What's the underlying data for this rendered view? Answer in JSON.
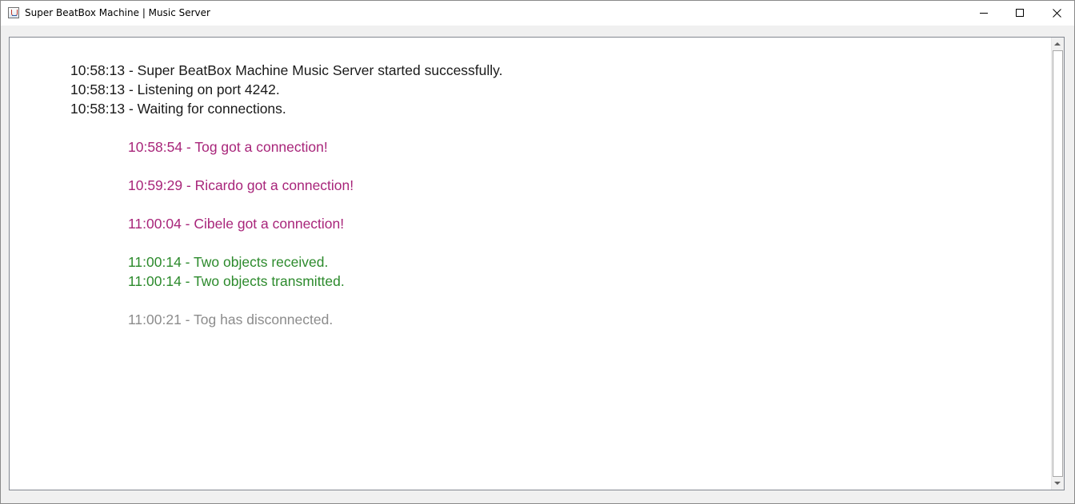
{
  "window": {
    "title": "Super BeatBox Machine | Music Server",
    "icon": "java-app-icon",
    "controls": {
      "minimize": "minimize-icon",
      "maximize": "maximize-icon",
      "close": "close-icon"
    }
  },
  "log": {
    "colors": {
      "system": "#1a1a1a",
      "connection": "#a8257a",
      "transfer": "#2c8a2c",
      "disconnect": "#8c8c8c"
    },
    "lines": [
      {
        "text": "10:58:13 - Super BeatBox Machine Music Server started successfully.",
        "kind": "system"
      },
      {
        "text": "10:58:13 - Listening on port 4242.",
        "kind": "system"
      },
      {
        "text": "10:58:13 - Waiting for connections.",
        "kind": "system"
      },
      {
        "text": "10:58:54 - Tog got a connection!",
        "kind": "connection"
      },
      {
        "text": "10:59:29 - Ricardo got a connection!",
        "kind": "connection"
      },
      {
        "text": "11:00:04 - Cibele got a connection!",
        "kind": "connection"
      },
      {
        "text": "11:00:14 - Two objects received.",
        "kind": "transfer"
      },
      {
        "text": "11:00:14 - Two objects transmitted.",
        "kind": "transfer"
      },
      {
        "text": "11:00:21 - Tog has disconnected.",
        "kind": "disconnect"
      }
    ]
  }
}
